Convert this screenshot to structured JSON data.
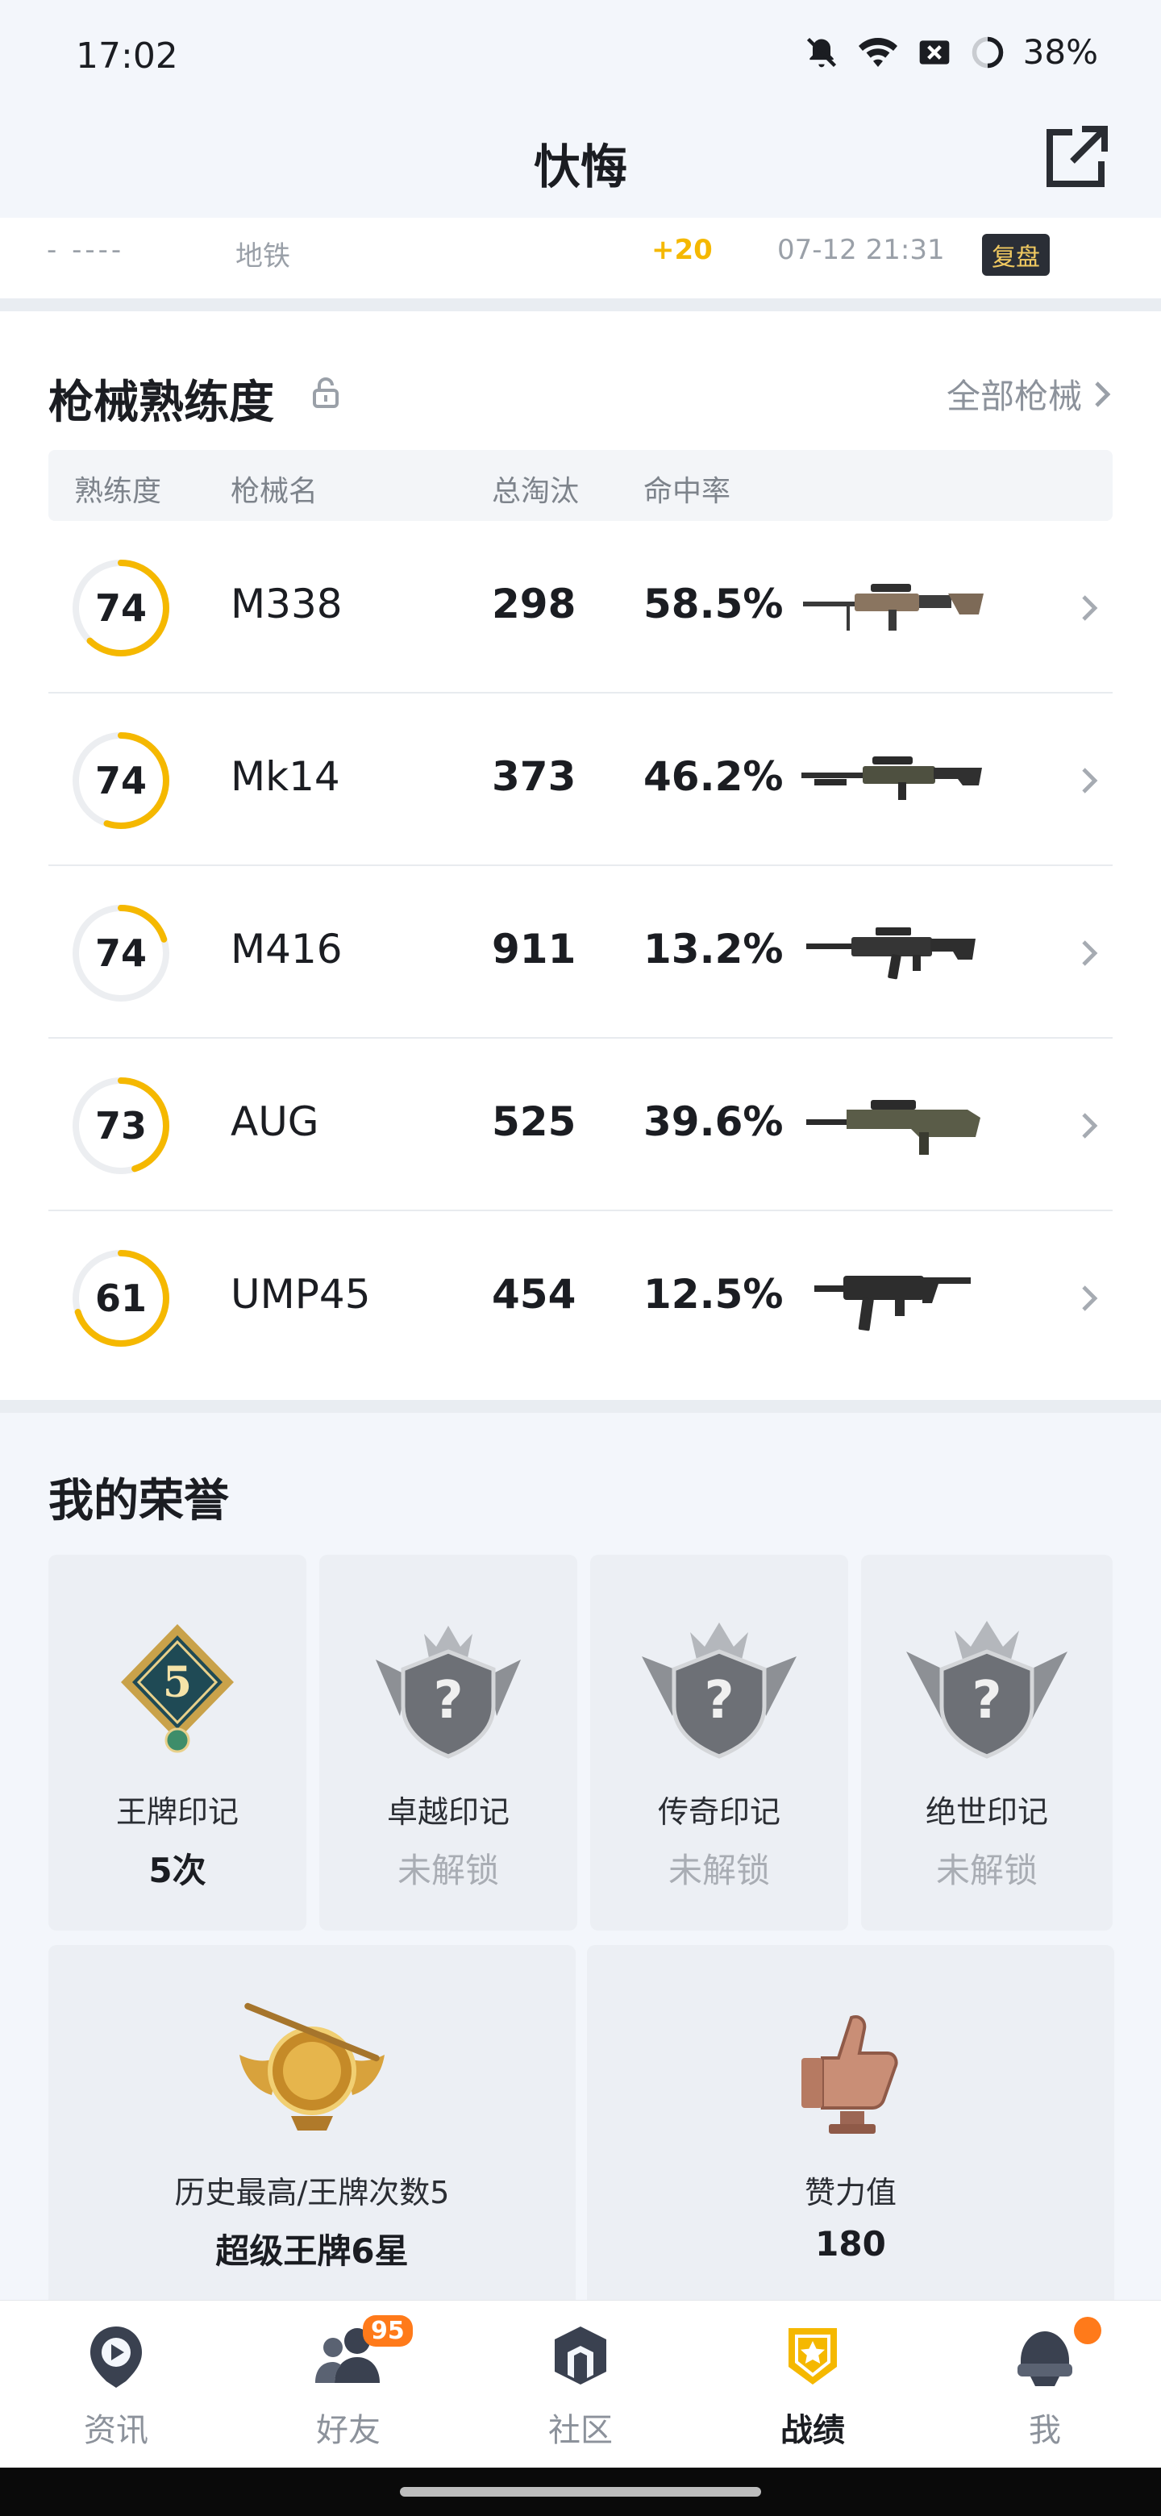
{
  "status_bar": {
    "time": "17:02",
    "battery": "38%"
  },
  "header": {
    "title": "忕悔"
  },
  "partial_match_row": {
    "dash": "- ----",
    "map": "地铁",
    "delta": "+20",
    "date": "07-12 21:31",
    "result_badge": "复盘"
  },
  "weapons": {
    "title": "枪械熟练度",
    "all_link": "全部枪械",
    "columns": {
      "mastery": "熟练度",
      "name": "枪械名",
      "kills": "总淘汰",
      "accuracy": "命中率"
    },
    "rows": [
      {
        "mastery": "74",
        "progress": 0.62,
        "name": "M338",
        "kills": "298",
        "accuracy": "58.5%",
        "icon": "sniper-rifle-icon"
      },
      {
        "mastery": "74",
        "progress": 0.55,
        "name": "Mk14",
        "kills": "373",
        "accuracy": "46.2%",
        "icon": "dmr-rifle-icon"
      },
      {
        "mastery": "74",
        "progress": 0.2,
        "name": "M416",
        "kills": "911",
        "accuracy": "13.2%",
        "icon": "assault-rifle-icon"
      },
      {
        "mastery": "73",
        "progress": 0.45,
        "name": "AUG",
        "kills": "525",
        "accuracy": "39.6%",
        "icon": "bullpup-rifle-icon"
      },
      {
        "mastery": "61",
        "progress": 0.7,
        "name": "UMP45",
        "kills": "454",
        "accuracy": "12.5%",
        "icon": "smg-icon"
      }
    ]
  },
  "honors": {
    "title": "我的荣誉",
    "marks": [
      {
        "label": "王牌印记",
        "value": "5次",
        "locked": false,
        "icon": "ace-mark-icon",
        "badge_number": "5"
      },
      {
        "label": "卓越印记",
        "value": "未解锁",
        "locked": true,
        "icon": "locked-mark-icon"
      },
      {
        "label": "传奇印记",
        "value": "未解锁",
        "locked": true,
        "icon": "locked-mark-icon"
      },
      {
        "label": "绝世印记",
        "value": "未解锁",
        "locked": true,
        "icon": "locked-mark-icon"
      }
    ],
    "highest": {
      "label": "历史最高/王牌次数5",
      "value": "超级王牌6星",
      "icon": "gold-rank-emblem-icon"
    },
    "likes": {
      "label": "赞力值",
      "value": "180",
      "icon": "thumbs-up-trophy-icon"
    }
  },
  "nav": {
    "items": [
      {
        "label": "资讯",
        "icon": "news-icon",
        "active": false
      },
      {
        "label": "好友",
        "icon": "friends-icon",
        "active": false,
        "badge": "95"
      },
      {
        "label": "社区",
        "icon": "community-icon",
        "active": false
      },
      {
        "label": "战绩",
        "icon": "record-icon",
        "active": true
      },
      {
        "label": "我",
        "icon": "profile-helmet-icon",
        "active": false,
        "dot": true
      }
    ]
  },
  "colors": {
    "accent": "#f5b800",
    "ring_track": "#eceef1",
    "badge": "#ff7a1a"
  }
}
